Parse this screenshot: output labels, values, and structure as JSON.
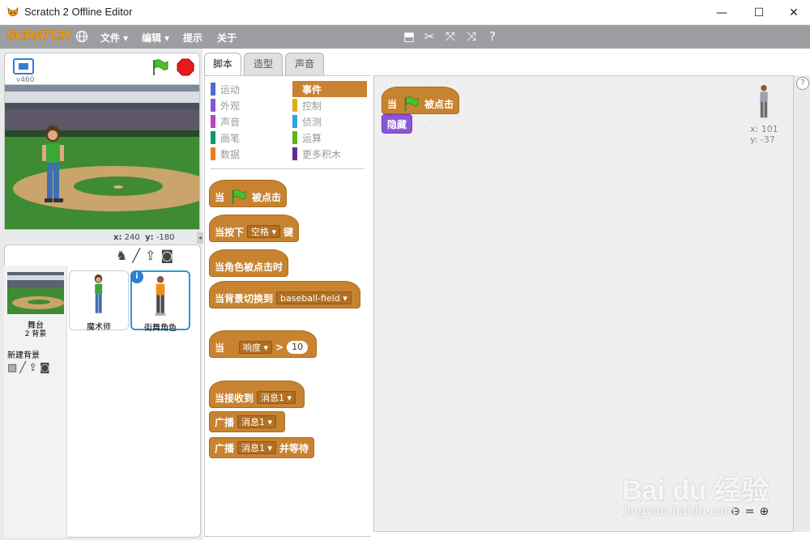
{
  "window": {
    "title": "Scratch 2 Offline Editor",
    "minimize": "—",
    "maximize": "☐",
    "close": "✕"
  },
  "menubar": {
    "logo": "SCRATCH",
    "file": "文件 ▾",
    "edit": "编辑 ▾",
    "tips": "提示",
    "about": "关于"
  },
  "stage": {
    "version": "v460",
    "coords": {
      "x_label": "x:",
      "x": "240",
      "y_label": "y:",
      "y": "-180"
    }
  },
  "tabs": [
    "脚本",
    "造型",
    "声音"
  ],
  "categories": {
    "left": [
      "运动",
      "外观",
      "声音",
      "画笔",
      "数据"
    ],
    "right": [
      "事件",
      "控制",
      "侦测",
      "运算",
      "更多积木"
    ],
    "colors_left": [
      "#4a6cd4",
      "#8a55d7",
      "#bb42c3",
      "#0e9a6c",
      "#ee7d16"
    ],
    "colors_right": [
      "#c88330",
      "#e1a91a",
      "#2ca5e2",
      "#5cb712",
      "#632d99"
    ]
  },
  "blocks": {
    "when_flag": {
      "when": "当",
      "clicked": "被点击"
    },
    "when_key": {
      "label": "当按下",
      "key": "空格",
      "suffix": "键"
    },
    "when_sprite_clicked": "当角色被点击时",
    "when_backdrop": {
      "label": "当背景切换到",
      "value": "baseball-field"
    },
    "when_sensor": {
      "when": "当",
      "sensor": "响度",
      "op": ">",
      "value": "10"
    },
    "when_receive": {
      "label": "当接收到",
      "value": "消息1"
    },
    "broadcast": {
      "label": "广播",
      "value": "消息1"
    },
    "broadcast_wait": {
      "label": "广播",
      "value": "消息1",
      "suffix": "并等待"
    }
  },
  "script": {
    "when": "当",
    "clicked": "被点击",
    "hide": "隐藏"
  },
  "sprite_info": {
    "x_label": "x:",
    "x": "101",
    "y_label": "y:",
    "y": "-37"
  },
  "sprites": {
    "stage_label": "舞台",
    "stage_backdrops": "2 背景",
    "new_backdrop": "新建背景",
    "list": [
      "魔术师",
      "街舞角色"
    ]
  },
  "watermark": {
    "brand": "Bai du 经验",
    "url": "jingyan.baidu.com"
  }
}
